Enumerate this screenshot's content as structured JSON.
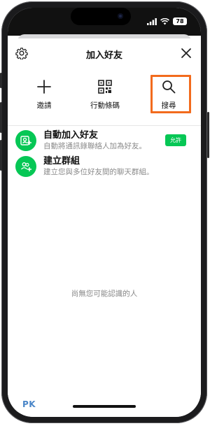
{
  "status_bar": {
    "time": "",
    "battery": "78"
  },
  "header": {
    "title": "加入好友"
  },
  "actions": [
    {
      "label": "邀請",
      "icon": "plus-icon"
    },
    {
      "label": "行動條碼",
      "icon": "qr-code-icon"
    },
    {
      "label": "搜尋",
      "icon": "search-icon"
    }
  ],
  "list": [
    {
      "name": "自動加入好友",
      "desc": "自動將通訊錄聯絡人加為好友。",
      "button": "允許",
      "icon": "contacts-add-icon"
    },
    {
      "name": "建立群組",
      "desc": "建立您與多位好友間的聊天群組。",
      "icon": "group-add-icon"
    }
  ],
  "empty_text": "尚無您可能認識的人",
  "watermark": {
    "main": "PK",
    "small": ""
  },
  "colors": {
    "accent_green": "#06c755",
    "highlight_orange": "#f26b1d"
  }
}
